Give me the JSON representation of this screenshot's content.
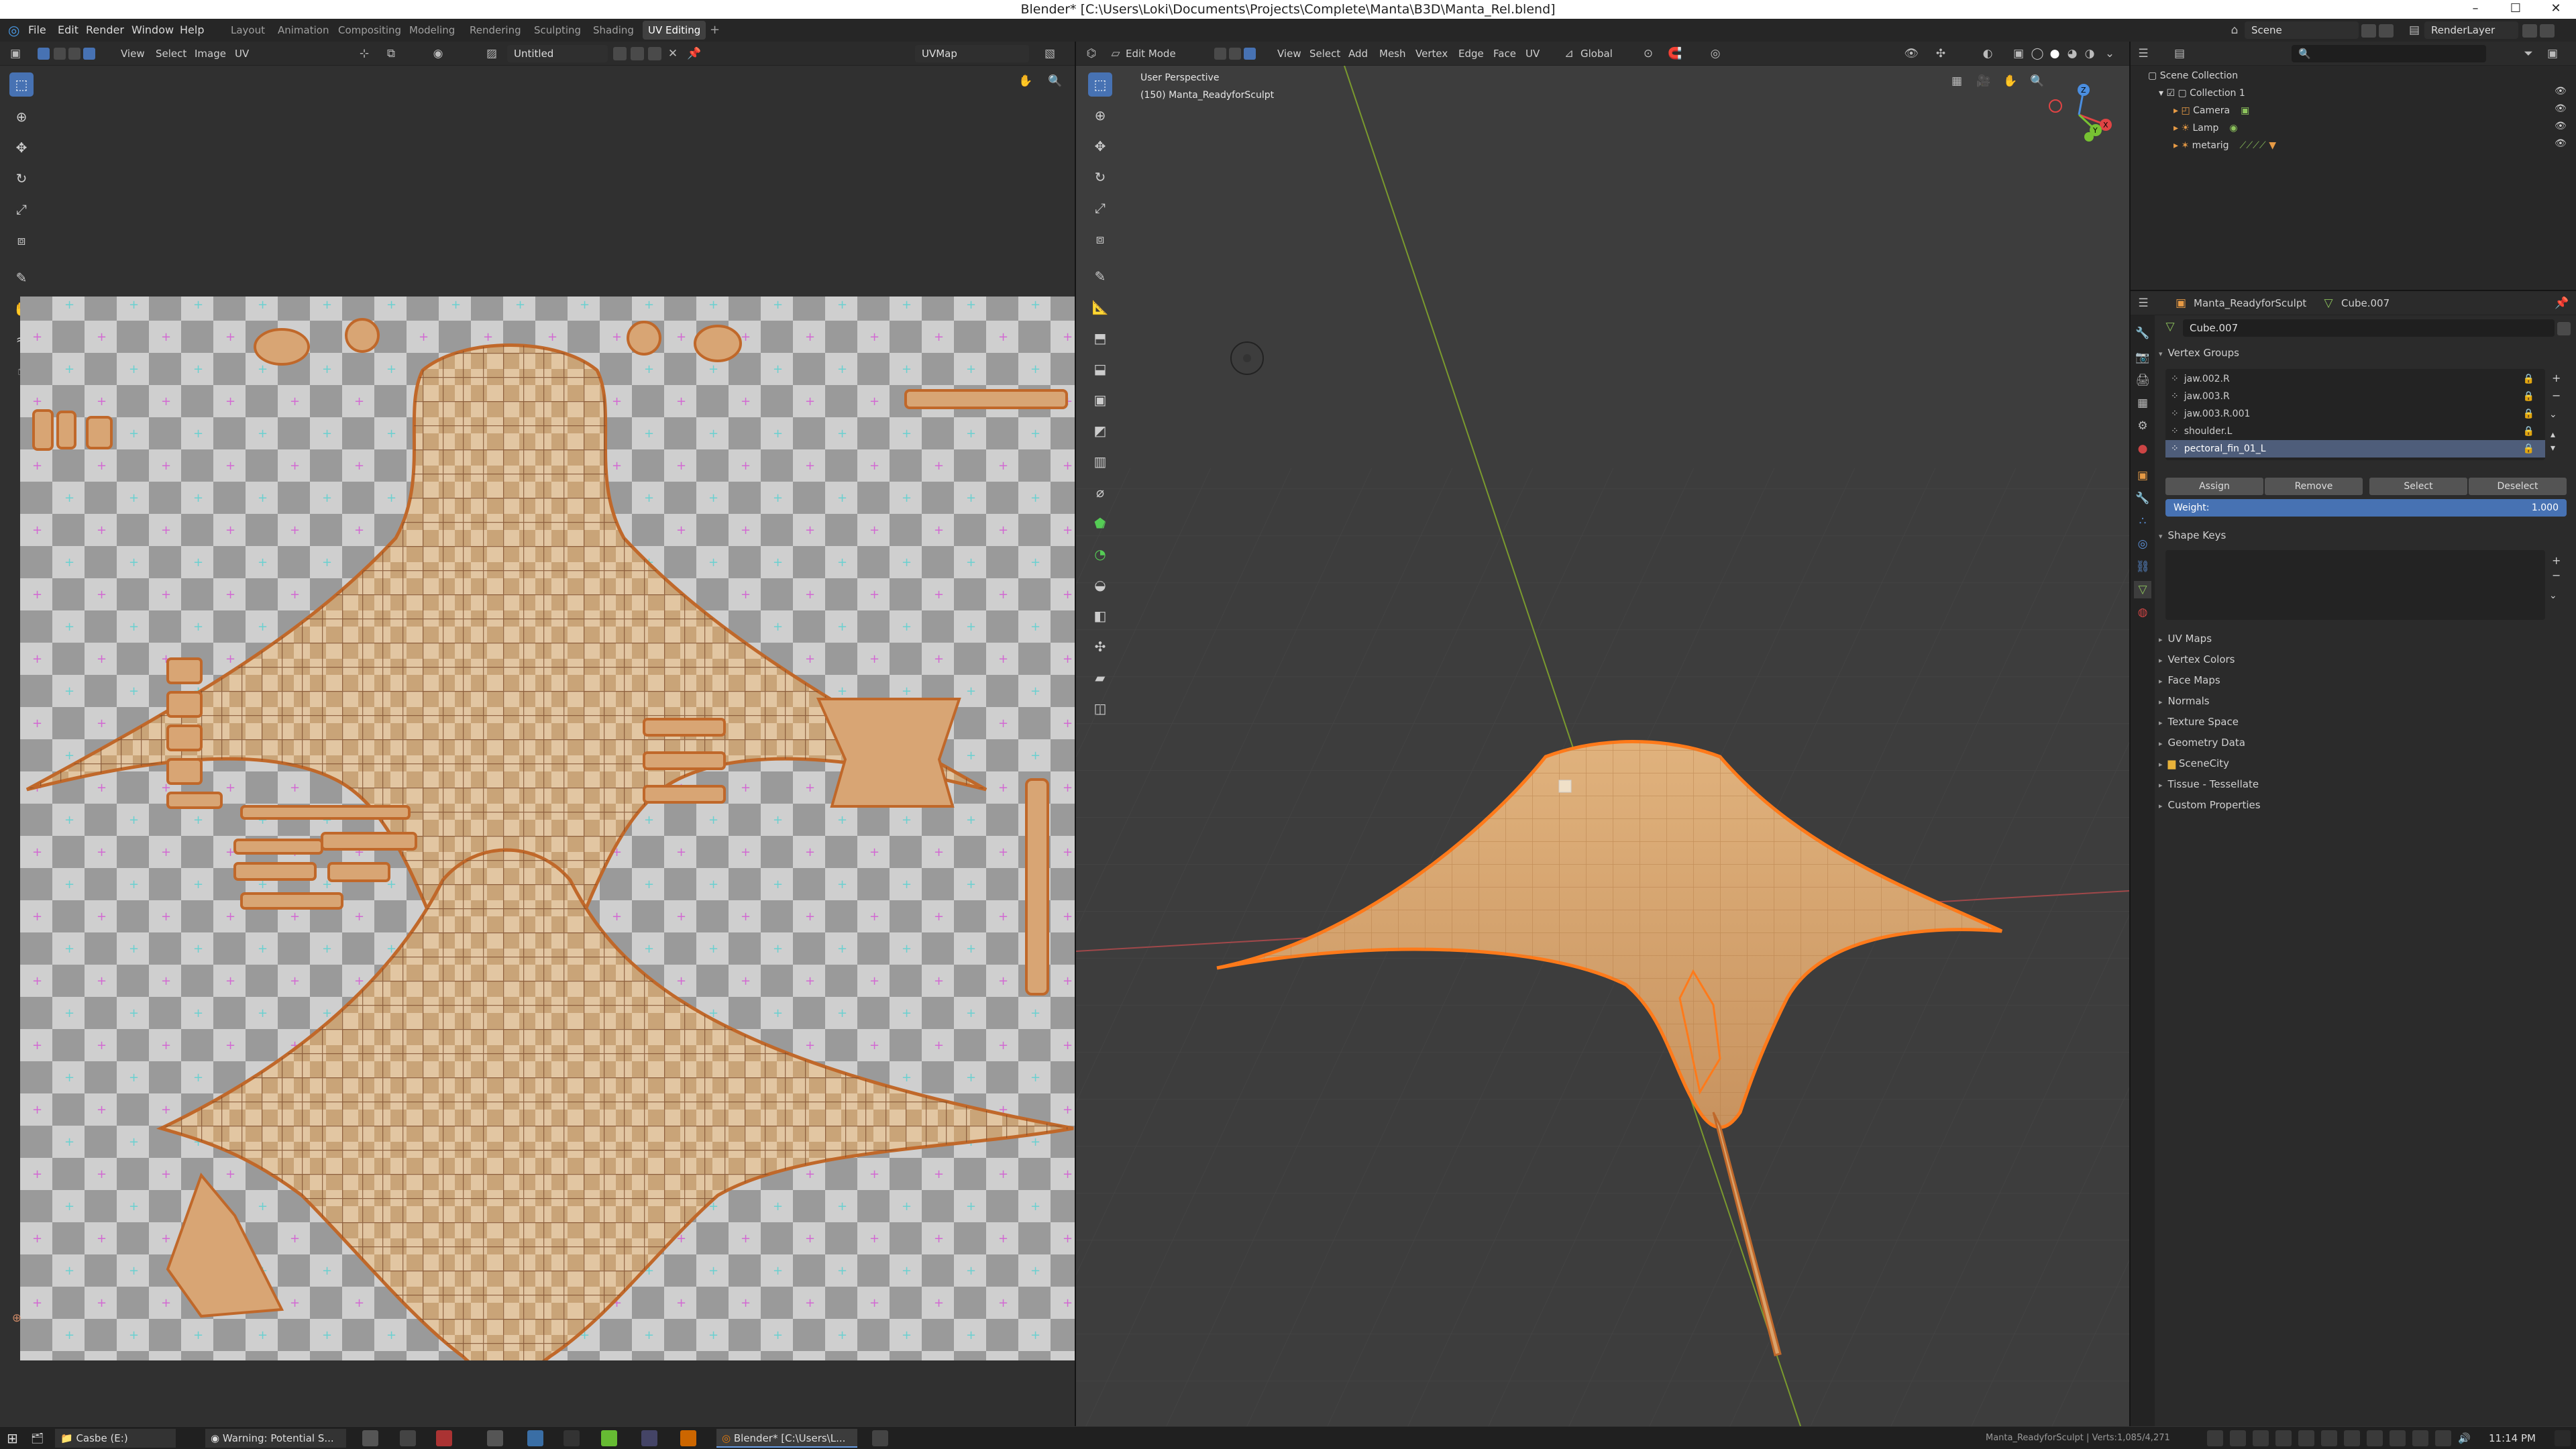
{
  "window": {
    "title": "Blender* [C:\\Users\\Loki\\Documents\\Projects\\Complete\\Manta\\B3D\\Manta_Rel.blend]",
    "minimize": "–",
    "maximize": "☐",
    "close": "✕"
  },
  "menu": [
    "File",
    "Edit",
    "Render",
    "Window",
    "Help"
  ],
  "workspaces": [
    "Layout",
    "Animation",
    "Compositing",
    "Modeling",
    "Rendering",
    "Sculpting",
    "Shading",
    "UV Editing",
    "+"
  ],
  "active_workspace": "UV Editing",
  "scene_label": "Scene",
  "view_layer_label": "RenderLayer",
  "uv_editor": {
    "header_menus": [
      "View",
      "Select",
      "Image",
      "UV"
    ],
    "image_name": "Untitled",
    "uvmap": "UVMap"
  },
  "viewport": {
    "mode": "Edit Mode",
    "menus": [
      "View",
      "Select",
      "Add",
      "Mesh",
      "Vertex",
      "Edge",
      "Face",
      "UV"
    ],
    "orientation": "Global",
    "info_line1": "User Perspective",
    "info_line2": "(150) Manta_ReadyforSculpt",
    "gizmo": {
      "x": "X",
      "y": "Y",
      "z": "Z"
    }
  },
  "outliner": {
    "root": "Scene Collection",
    "collection": "Collection 1",
    "items": [
      "Camera",
      "Lamp",
      "metarig"
    ]
  },
  "properties": {
    "object_name": "Manta_ReadyforSculpt",
    "mesh_name": "Cube.007",
    "data_field": "Cube.007",
    "vertex_groups_title": "Vertex Groups",
    "vertex_groups": [
      "jaw.002.R",
      "jaw.003.R",
      "jaw.003.R.001",
      "shoulder.L",
      "pectoral_fin_01_L"
    ],
    "buttons": {
      "assign": "Assign",
      "remove": "Remove",
      "select": "Select",
      "deselect": "Deselect"
    },
    "weight_label": "Weight:",
    "weight_value": "1.000",
    "shape_keys_title": "Shape Keys",
    "panels": [
      "UV Maps",
      "Vertex Colors",
      "Face Maps",
      "Normals",
      "Texture Space",
      "Geometry Data",
      "SceneCity",
      "Tissue - Tessellate",
      "Custom Properties"
    ]
  },
  "statusbar": {
    "text": "Manta_ReadyforSculpt | Verts:1,085/4,271"
  },
  "taskbar": {
    "items": [
      "Casbe (E:)",
      "Warning: Potential S...",
      "Blender* [C:\\Users\\L..."
    ],
    "clock": "11:14 PM"
  },
  "colors": {
    "accent": "#4772b3",
    "mesh": "#d4a472",
    "edge": "#c0682a",
    "select": "#ff7a1a"
  }
}
